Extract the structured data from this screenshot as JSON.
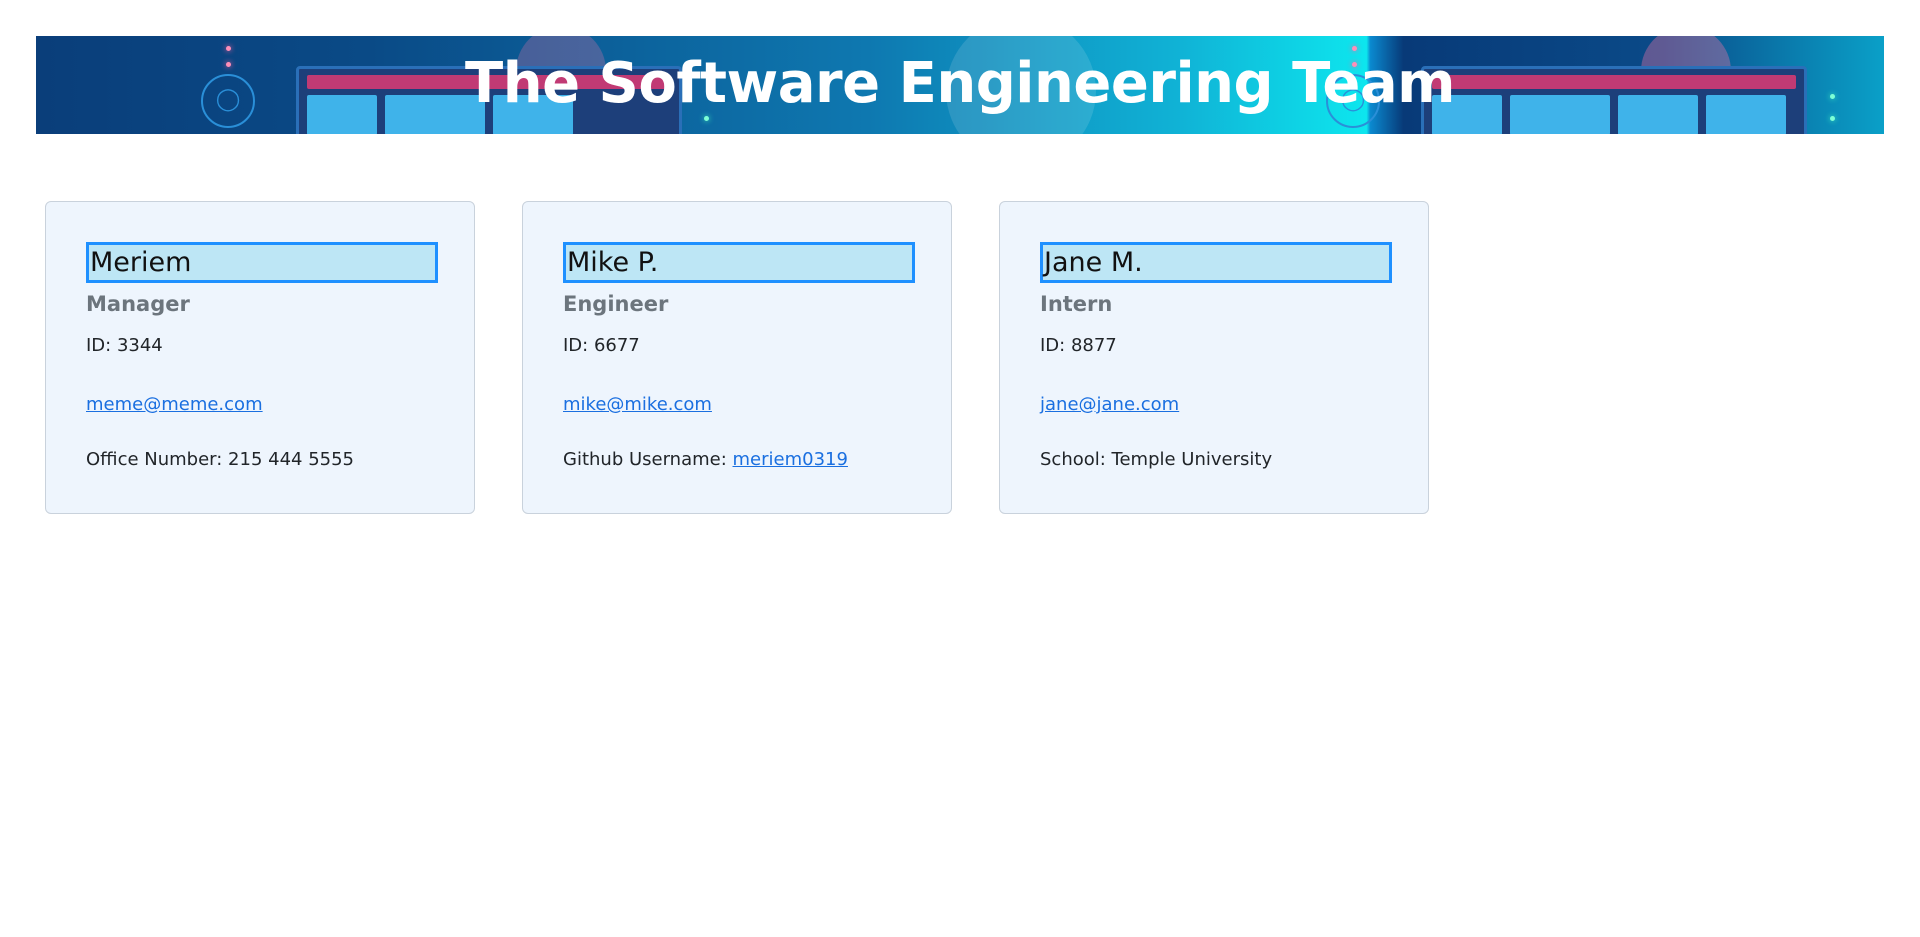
{
  "header": {
    "title": "The Software Engineering Team"
  },
  "team": [
    {
      "name": "Meriem",
      "role": "Manager",
      "id_label": "ID: 3344",
      "email": "meme@meme.com",
      "extra_label": "Office Number: 215 444 5555",
      "extra_link": ""
    },
    {
      "name": "Mike P.",
      "role": "Engineer",
      "id_label": "ID: 6677",
      "email": "mike@mike.com",
      "extra_label": "Github Username: ",
      "extra_link": "meriem0319"
    },
    {
      "name": "Jane M.",
      "role": "Intern",
      "id_label": "ID: 8877",
      "email": "jane@jane.com",
      "extra_label": "School: Temple University",
      "extra_link": ""
    }
  ],
  "colors": {
    "accent": "#1e90ff",
    "name_bg": "#bde6f5",
    "card_bg": "#eef5fd",
    "link": "#1a6fe0",
    "role_text": "#6c757d"
  }
}
